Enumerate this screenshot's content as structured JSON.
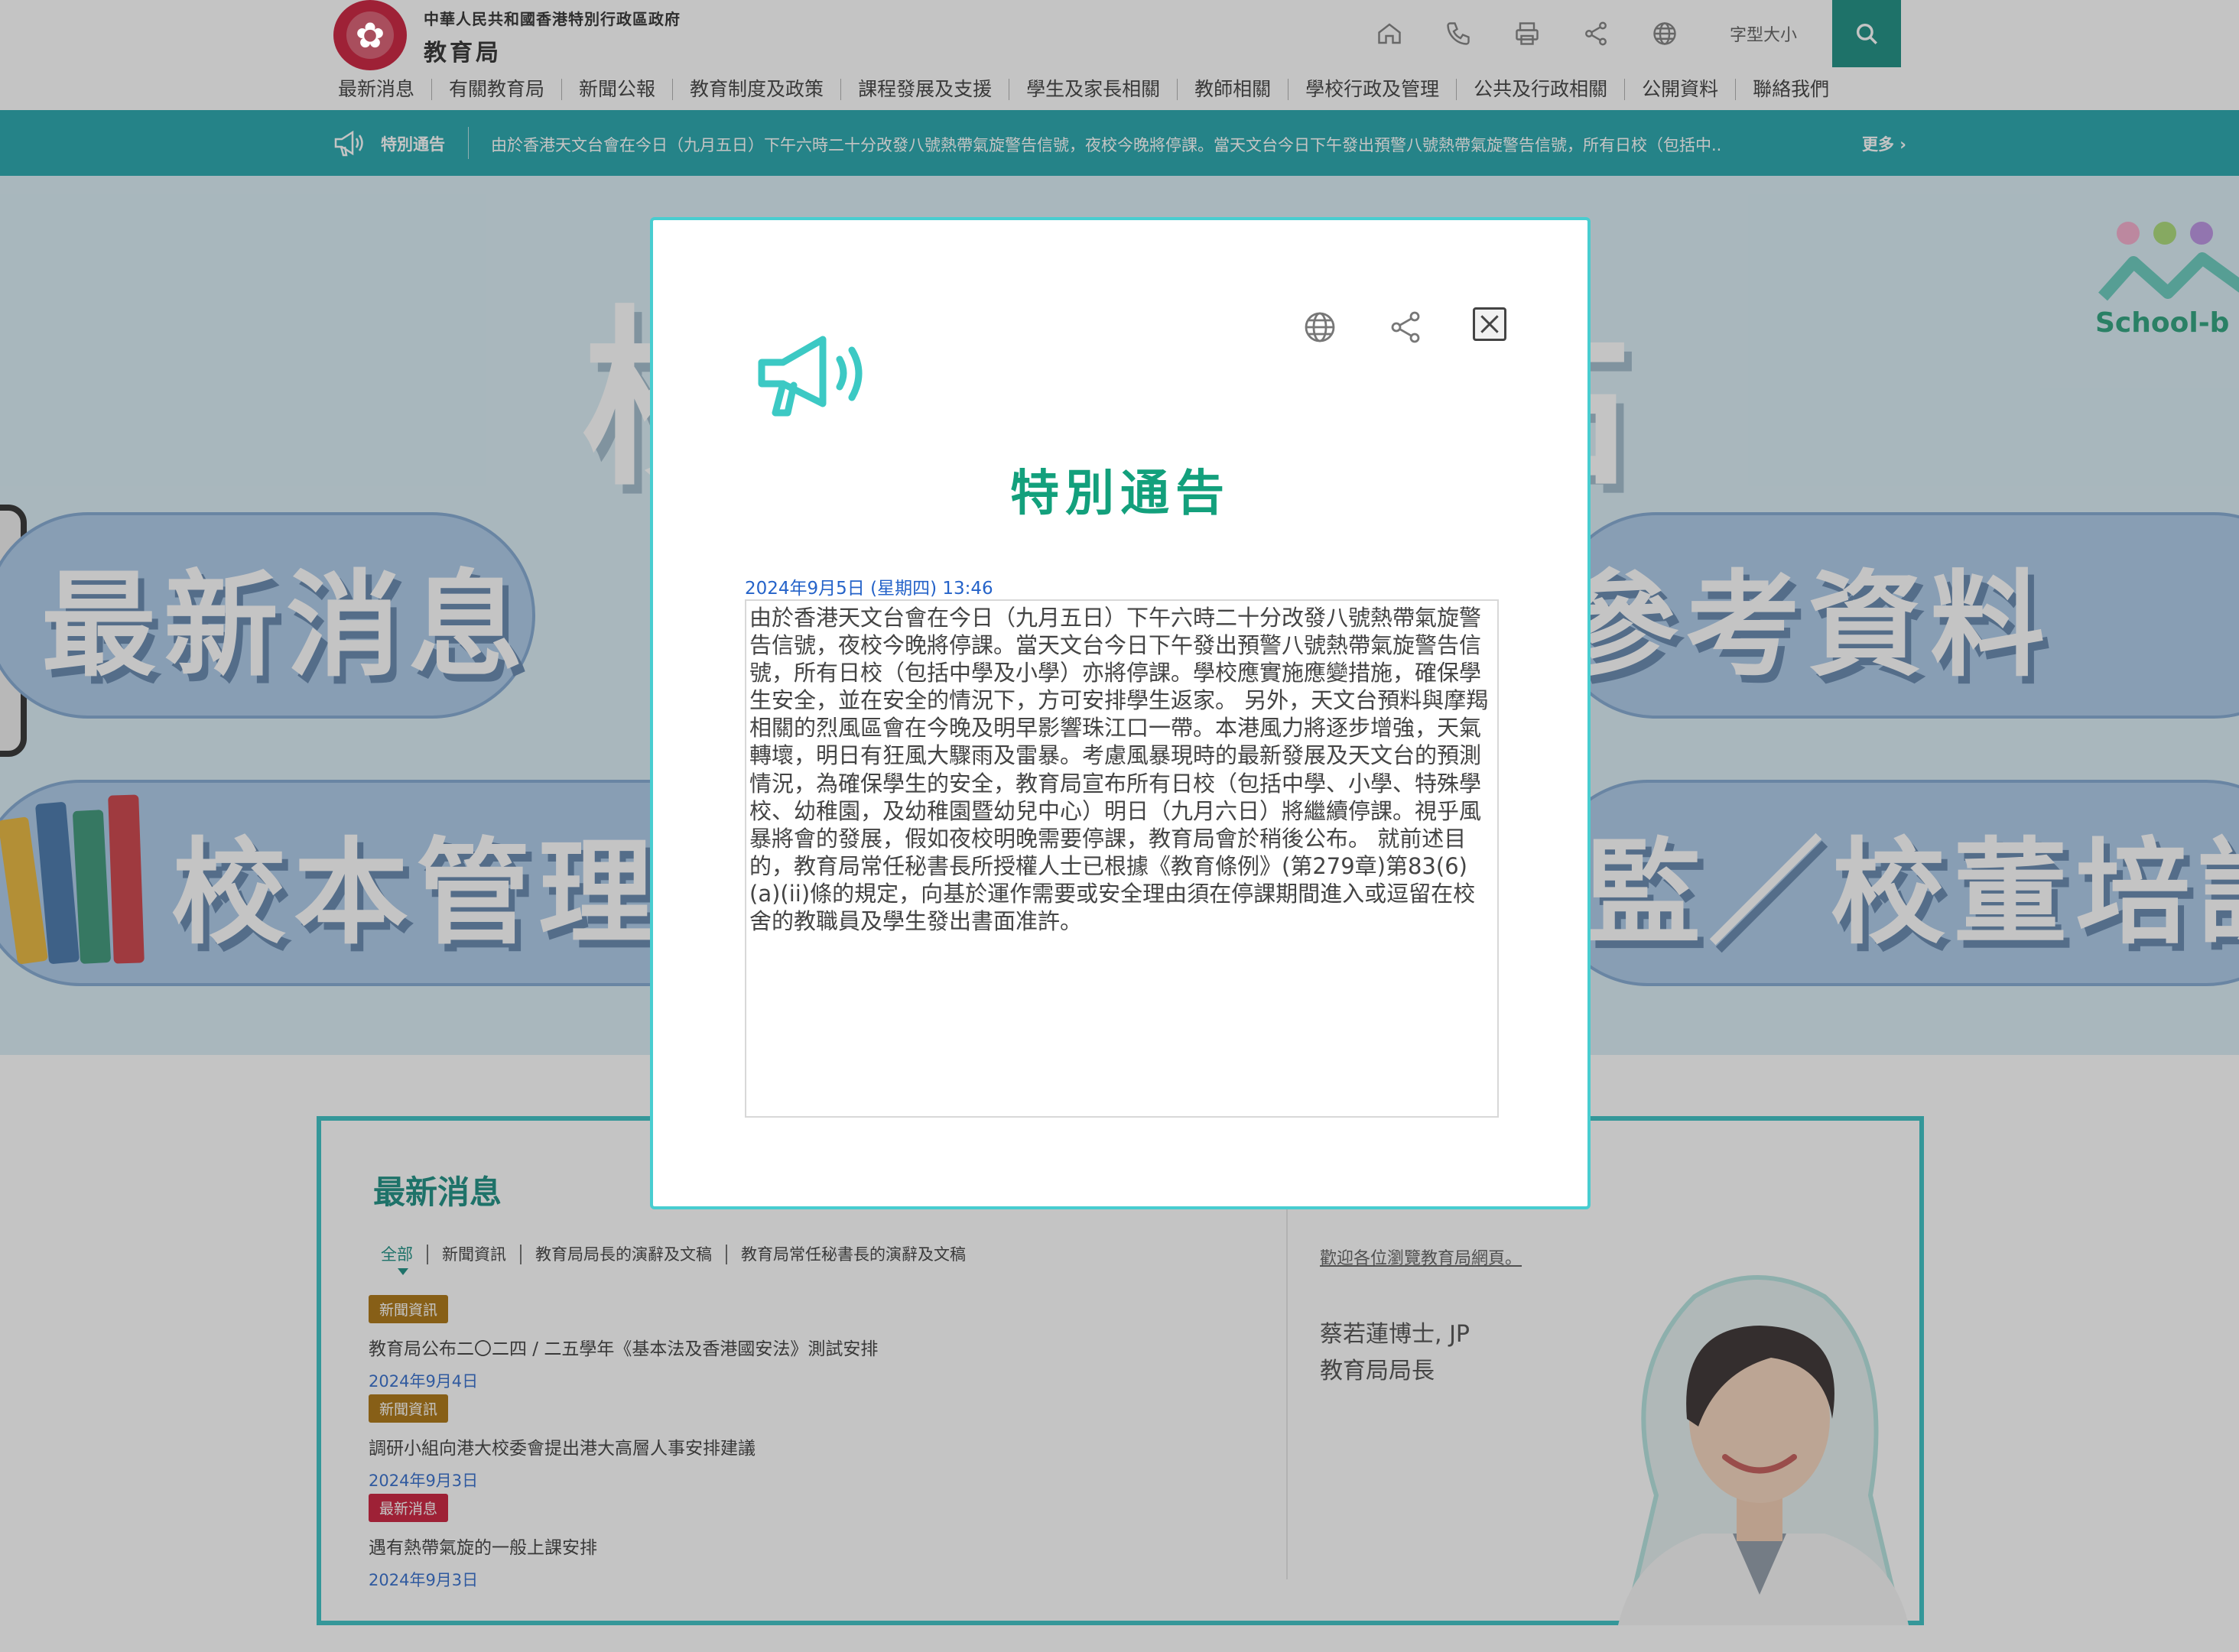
{
  "header": {
    "org_line1": "中華人民共和國香港特別行政區政府",
    "org_line2": "教育局",
    "font_size_label": "字型大小"
  },
  "nav": [
    "最新消息",
    "有關教育局",
    "新聞公報",
    "教育制度及政策",
    "課程發展及支援",
    "學生及家長相關",
    "教師相關",
    "學校行政及管理",
    "公共及行政相關",
    "公開資料",
    "聯絡我們"
  ],
  "notice_bar": {
    "label": "特別通告",
    "text": "由於香港天文台會在今日（九月五日）下午六時二十分改發八號熱帶氣旋警告信號，夜校今晚將停課。當天文台今日下午發出預警八號熱帶氣旋警告信號，所有日校（包括中...",
    "more": "更多 ›"
  },
  "banner": {
    "title": "校本資料站",
    "pill_a": "最新消息",
    "pill_b": "參考資料",
    "pill_c": "校本管理",
    "pill_d": "監／校董培訓課",
    "sb_text": "School-b"
  },
  "news": {
    "title": "最新消息",
    "tabs": [
      "全部",
      "新聞資訊",
      "教育局局長的演辭及文稿",
      "教育局常任秘書長的演辭及文稿"
    ],
    "items": [
      {
        "tag": "新聞資訊",
        "tag_color": "#a66b00",
        "headline": "教育局公布二〇二四 / 二五學年《基本法及香港國安法》測試安排",
        "date": "2024年9月4日"
      },
      {
        "tag": "新聞資訊",
        "tag_color": "#a66b00",
        "headline": "調研小組向港大校委會提出港大高層人事安排建議",
        "date": "2024年9月3日"
      },
      {
        "tag": "最新消息",
        "tag_color": "#c8102e",
        "headline": "遇有熱帶氣旋的一般上課安排",
        "date": "2024年9月3日"
      }
    ],
    "welcome_link": "歡迎各位瀏覽教育局網頁。",
    "secretary_name": "蔡若蓮博士, JP",
    "secretary_title": "教育局局長"
  },
  "modal": {
    "title": "特別通告",
    "date": "2024年9月5日 (星期四) 13:46",
    "body": "由於香港天文台會在今日（九月五日）下午六時二十分改發八號熱帶氣旋警告信號，夜校今晚將停課。當天文台今日下午發出預警八號熱帶氣旋警告信號，所有日校（包括中學及小學）亦將停課。學校應實施應變措施，確保學生安全，並在安全的情況下，方可安排學生返家。 另外，天文台預料與摩羯相關的烈風區會在今晚及明早影響珠江口一帶。本港風力將逐步增強，天氣轉壞，明日有狂風大驟雨及雷暴。考慮風暴現時的最新發展及天文台的預測情況，為確保學生的安全，教育局宣布所有日校（包括中學、小學、特殊學校、幼稚園，及幼稚園暨幼兒中心）明日（九月六日）將繼續停課。視乎風暴將會的發展，假如夜校明晚需要停課，教育局會於稍後公布。 就前述目的，教育局常任秘書長所授權人士已根據《教育條例》(第279章)第83(6)(a)(ii)條的規定，向基於運作需要或安全理由須在停課期間進入或逗留在校舍的教職員及學生發出書面准許。"
  },
  "colors": {
    "accent": "#0b8779",
    "notice_bar": "#16a0a7",
    "modal_border": "#48cdd0",
    "modal_title": "#13a07c",
    "date_blue": "#2563c9"
  }
}
